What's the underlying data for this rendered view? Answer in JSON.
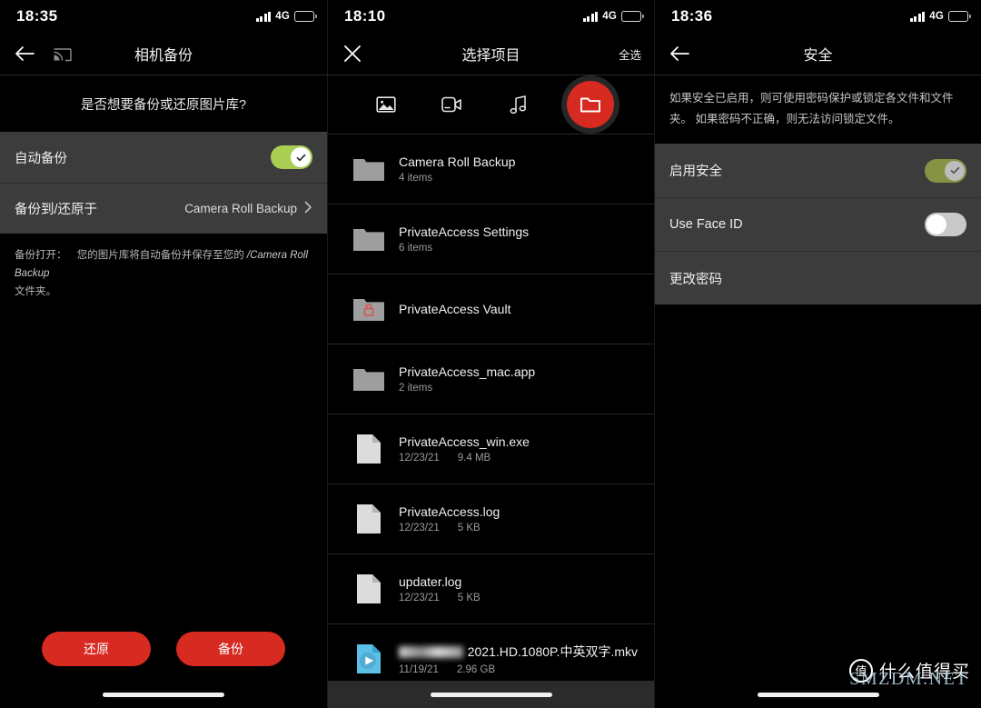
{
  "accent": {
    "red": "#d72a20",
    "green": "#a9ce52",
    "green_dim": "#879344",
    "battery": "#f5c518"
  },
  "panel1": {
    "status": {
      "time": "18:35",
      "network": "4G",
      "signal_icon": "signal-bars-icon",
      "battery_icon": "battery-icon"
    },
    "appbar": {
      "back_icon": "back-arrow-icon",
      "cast_icon": "cast-icon",
      "title": "相机备份"
    },
    "question": "是否想要备份或还原图片库?",
    "rows": [
      {
        "label": "自动备份",
        "type": "toggle",
        "state": "on",
        "icon": "check-icon"
      },
      {
        "label": "备份到/还原于",
        "type": "value",
        "value": "Camera Roll Backup",
        "chevron": "›",
        "chevron_icon": "chevron-right-icon"
      }
    ],
    "note_prefix": "备份打开：",
    "note_body": "您的图片库将自动备份并保存至您的 ",
    "note_path": "/Camera Roll Backup",
    "note_suffix": "文件夹。",
    "buttons": [
      {
        "label": "还原",
        "name": "restore-button"
      },
      {
        "label": "备份",
        "name": "backup-button"
      }
    ]
  },
  "panel2": {
    "status": {
      "time": "18:10",
      "network": "4G",
      "signal_icon": "signal-bars-icon",
      "battery_icon": "battery-icon"
    },
    "appbar": {
      "close_icon": "close-icon",
      "title": "选择项目",
      "select_all": "全选"
    },
    "tabs": [
      {
        "icon": "image-icon",
        "name": "tab-images",
        "active": false
      },
      {
        "icon": "video-icon",
        "name": "tab-videos",
        "active": false
      },
      {
        "icon": "music-icon",
        "name": "tab-music",
        "active": false
      },
      {
        "icon": "folder-icon",
        "name": "tab-files",
        "active": true
      }
    ],
    "files": [
      {
        "name": "Camera Roll Backup",
        "meta1": "4 items",
        "meta2": "",
        "icon": "folder-icon"
      },
      {
        "name": "PrivateAccess Settings",
        "meta1": "6 items",
        "meta2": "",
        "icon": "folder-icon"
      },
      {
        "name": "PrivateAccess Vault",
        "meta1": "",
        "meta2": "",
        "icon": "folder-locked-icon"
      },
      {
        "name": "PrivateAccess_mac.app",
        "meta1": "2 items",
        "meta2": "",
        "icon": "folder-icon"
      },
      {
        "name": "PrivateAccess_win.exe",
        "meta1": "12/23/21",
        "meta2": "9.4 MB",
        "icon": "document-icon"
      },
      {
        "name": "PrivateAccess.log",
        "meta1": "12/23/21",
        "meta2": "5 KB",
        "icon": "document-icon"
      },
      {
        "name": "updater.log",
        "meta1": "12/23/21",
        "meta2": "5 KB",
        "icon": "document-icon"
      },
      {
        "name": "2021.HD.1080P.中英双字.mkv",
        "meta1": "11/19/21",
        "meta2": "2.96 GB",
        "icon": "video-file-icon",
        "redacted": true
      }
    ]
  },
  "panel3": {
    "status": {
      "time": "18:36",
      "network": "4G",
      "signal_icon": "signal-bars-icon",
      "battery_icon": "battery-icon"
    },
    "appbar": {
      "back_icon": "back-arrow-icon",
      "title": "安全"
    },
    "description": "如果安全已启用，则可使用密码保护或锁定各文件和文件夹。 如果密码不正确，则无法访问锁定文件。",
    "rows": [
      {
        "label": "启用安全",
        "type": "toggle",
        "state": "on-dim"
      },
      {
        "label": "Use Face ID",
        "type": "toggle",
        "state": "off"
      },
      {
        "label": "更改密码",
        "type": "plain"
      }
    ],
    "watermark": {
      "badge": "值",
      "text": "什么值得买",
      "sub": "SMZDM.NET"
    }
  }
}
